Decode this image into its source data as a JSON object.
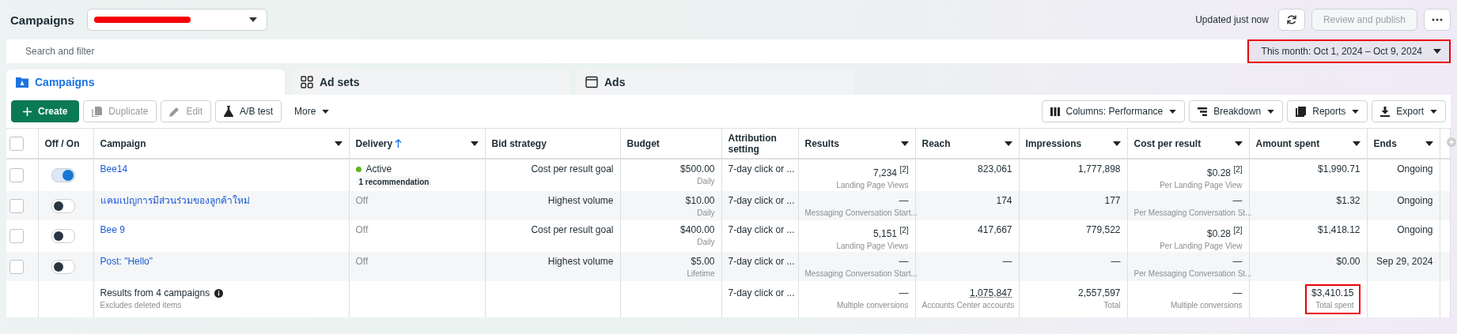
{
  "header": {
    "title": "Campaigns",
    "updated": "Updated just now",
    "publish_button": {
      "label": "Review and publish",
      "disabled": true
    }
  },
  "search": {
    "placeholder": "Search and filter"
  },
  "date_range": {
    "label": "This month: Oct 1, 2024 – Oct 9, 2024",
    "highlighted": true
  },
  "tabs": [
    {
      "label": "Campaigns",
      "selected": true,
      "kind": "campaigns"
    },
    {
      "label": "Ad sets",
      "selected": false,
      "kind": "adsets"
    },
    {
      "label": "Ads",
      "selected": false,
      "kind": "ads"
    }
  ],
  "toolbar_left": [
    {
      "label": "Create",
      "kind": "create",
      "disabled": false
    },
    {
      "label": "Duplicate",
      "kind": "duplicate",
      "disabled": true
    },
    {
      "label": "Edit",
      "kind": "edit",
      "disabled": true
    },
    {
      "label": "A/B test",
      "kind": "abtest",
      "disabled": false
    },
    {
      "label": "More",
      "kind": "more",
      "disabled": false
    }
  ],
  "toolbar_right": [
    {
      "label": "Columns: Performance",
      "kind": "columns"
    },
    {
      "label": "Breakdown",
      "kind": "breakdown"
    },
    {
      "label": "Reports",
      "kind": "reports"
    },
    {
      "label": "Export",
      "kind": "export"
    }
  ],
  "table": {
    "select_all": {
      "checked": false
    },
    "columns": [
      {
        "label": "Off / On",
        "menu": false,
        "sorted": false
      },
      {
        "label": "Campaign",
        "menu": true,
        "sorted": false
      },
      {
        "label": "Delivery",
        "menu": true,
        "sorted": true
      },
      {
        "label": "Bid strategy",
        "menu": false,
        "sorted": false
      },
      {
        "label": "Budget",
        "menu": false,
        "sorted": false
      },
      {
        "label": "Attribution setting",
        "menu": false,
        "sorted": false
      },
      {
        "label": "Results",
        "menu": true,
        "sorted": false
      },
      {
        "label": "Reach",
        "menu": true,
        "sorted": false
      },
      {
        "label": "Impressions",
        "menu": true,
        "sorted": false
      },
      {
        "label": "Cost per result",
        "menu": true,
        "sorted": false
      },
      {
        "label": "Amount spent",
        "menu": true,
        "sorted": false
      },
      {
        "label": "Ends",
        "menu": true,
        "sorted": false
      }
    ],
    "rows": [
      {
        "selected": false,
        "on": true,
        "campaign": "Bee14",
        "delivery": "Active",
        "active": true,
        "recommendation": "1 recommendation",
        "bid_strategy": "Cost per result goal",
        "budget": "$500.00",
        "budget_period": "Daily",
        "attribution": "7-day click or ...",
        "results": "7,234 $^{[2]}$",
        "results_label": "Landing Page Views",
        "reach": "823,061",
        "impressions": "1,777,898",
        "cost_per_result": "$0.28 $^{[2]}$",
        "cost_label": "Per Landing Page View",
        "spent": "$1,990.71",
        "ends": "Ongoing"
      },
      {
        "selected": false,
        "on": false,
        "campaign": "แคมเปญการมีส่วนร่วมของลูกค้าใหม่",
        "delivery": "Off",
        "active": false,
        "bid_strategy": "Highest volume",
        "budget": "$10.00",
        "budget_period": "Daily",
        "attribution": "7-day click or ...",
        "results": "—",
        "results_label": "Messaging Conversation Start...",
        "reach": "174",
        "impressions": "177",
        "cost_per_result": "—",
        "cost_label": "Per Messaging Conversation St...",
        "spent": "$1.32",
        "ends": "Ongoing"
      },
      {
        "selected": false,
        "on": false,
        "campaign": "Bee 9",
        "delivery": "Off",
        "active": false,
        "bid_strategy": "Cost per result goal",
        "budget": "$400.00",
        "budget_period": "Daily",
        "attribution": "7-day click or ...",
        "results": "5,151 $^{[2]}$",
        "results_label": "Landing Page Views",
        "reach": "417,667",
        "impressions": "779,522",
        "cost_per_result": "$0.28 $^{[2]}$",
        "cost_label": "Per Landing Page View",
        "spent": "$1,418.12",
        "ends": "Ongoing"
      },
      {
        "selected": false,
        "on": false,
        "campaign": "Post: \"Hello\"",
        "delivery": "Off",
        "active": false,
        "bid_strategy": "Highest volume",
        "budget": "$5.00",
        "budget_period": "Lifetime",
        "attribution": "7-day click or ...",
        "results": "—",
        "results_label": "Messaging Conversation Start...",
        "reach": "—",
        "impressions": "—",
        "cost_per_result": "—",
        "cost_label": "Per Messaging Conversation St...",
        "spent": "$0.00",
        "ends": "Sep 29, 2024"
      }
    ],
    "summary": {
      "title": "Results from 4 campaigns",
      "note": "Excludes deleted items",
      "attribution": "7-day click or ...",
      "results": "—",
      "results_label": "Multiple conversions",
      "reach": "1,075,847",
      "reach_label": "Accounts Center accounts",
      "impressions": "2,557,597",
      "impressions_label": "Total",
      "cost_per_result": "—",
      "cost_label": "Multiple conversions",
      "spent": "$3,410.15",
      "spent_label": "Total spent",
      "spent_highlighted": true
    }
  }
}
